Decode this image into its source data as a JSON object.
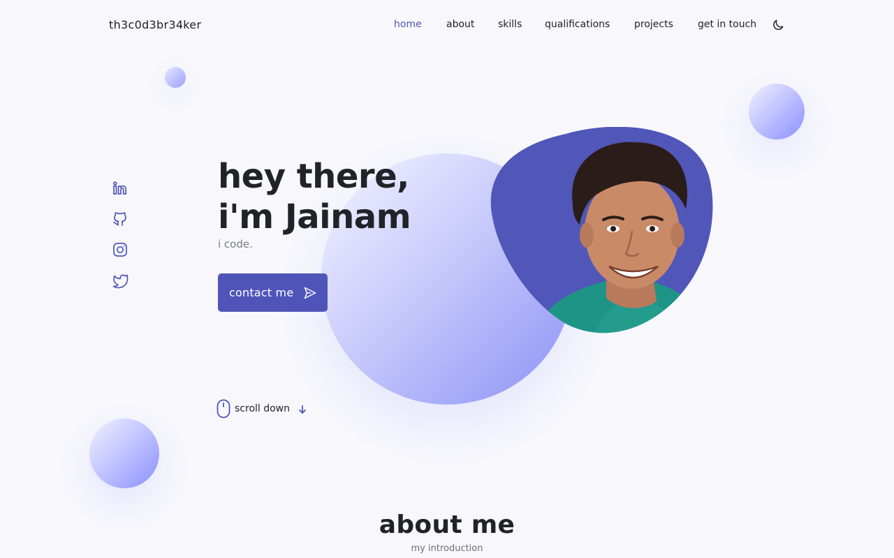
{
  "header": {
    "logo": "th3c0d3br34ker",
    "nav": [
      {
        "label": "home",
        "active": true
      },
      {
        "label": "about",
        "active": false
      },
      {
        "label": "skills",
        "active": false
      },
      {
        "label": "qualifications",
        "active": false
      },
      {
        "label": "projects",
        "active": false
      },
      {
        "label": "get in touch",
        "active": false
      }
    ],
    "theme_icon": "moon-icon"
  },
  "social": [
    {
      "icon": "linkedin-icon"
    },
    {
      "icon": "github-icon"
    },
    {
      "icon": "instagram-icon"
    },
    {
      "icon": "twitter-icon"
    }
  ],
  "hero": {
    "title_line1": "hey there,",
    "title_line2": "i'm Jainam",
    "subtitle": "i code.",
    "contact_label": "contact me",
    "contact_icon": "send-icon",
    "scroll_label": "scroll down",
    "scroll_icons": [
      "mouse-icon",
      "arrow-down-icon"
    ]
  },
  "about": {
    "title": "about me",
    "subtitle": "my introduction"
  },
  "colors": {
    "accent": "#4f55b8",
    "background": "#f8f8fc",
    "text": "#222229",
    "muted": "#7a7a85",
    "orb_gradient_end": "#8b92f6"
  }
}
